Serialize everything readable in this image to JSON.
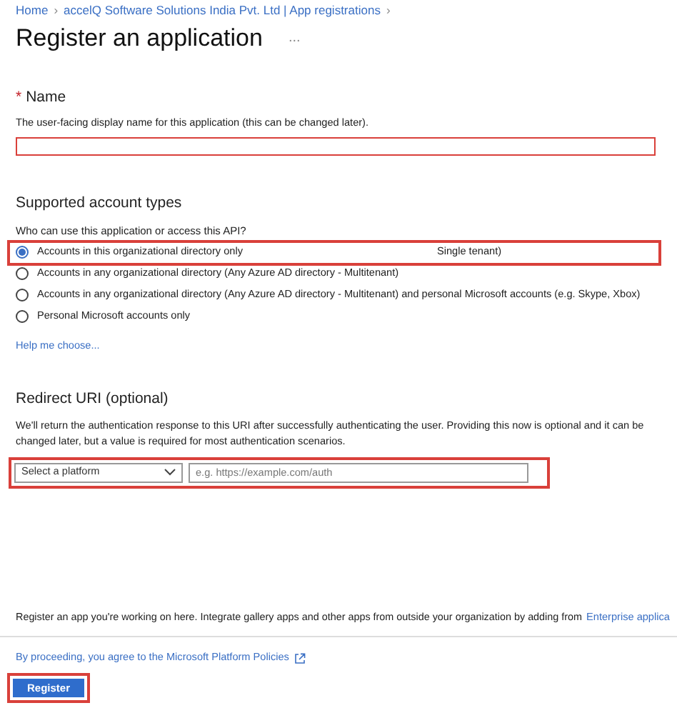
{
  "breadcrumb": [
    {
      "label": "Home",
      "separator": "›"
    },
    {
      "label": "accelQ Software Solutions India Pvt. Ltd | App registrations",
      "separator": "›"
    }
  ],
  "title": "Register an application",
  "more": "...",
  "name_section": {
    "required_mark": "*",
    "label": "Name",
    "description": "The user-facing display name for this application (this can be changed later).",
    "highlighted": true
  },
  "account_types": {
    "heading": "Supported account types",
    "question": "Who can use this application or access this API?",
    "options": [
      {
        "label": "Accounts in this organizational directory only",
        "label_tail": "Single tenant)",
        "selected": true,
        "highlighted": true
      },
      {
        "label": "Accounts in any organizational directory (Any Azure AD directory - Multitenant)",
        "selected": false,
        "highlighted": false
      },
      {
        "label": "Accounts in any organizational directory (Any Azure AD directory - Multitenant) and personal Microsoft accounts (e.g. Skype, Xbox)",
        "selected": false,
        "highlighted": false
      },
      {
        "label": "Personal Microsoft accounts only",
        "selected": false,
        "highlighted": false
      }
    ],
    "help_link": "Help me choose..."
  },
  "redirect": {
    "heading": "Redirect URI (optional)",
    "description": "We'll return the authentication response to this URI after successfully authenticating the user. Providing this now is optional and it can be changed later, but a value is required for most authentication scenarios.",
    "platform": "Select a platform",
    "placeholder": "e.g. https://example.com/auth",
    "highlighted": true
  },
  "footer": {
    "note": "Register an app you're working on here. Integrate gallery apps and other apps from outside your organization by adding from",
    "note_link": "Enterprise applica",
    "policies": "By proceeding, you agree to the Microsoft Platform Policies",
    "button": "Register",
    "button_highlighted": true
  }
}
